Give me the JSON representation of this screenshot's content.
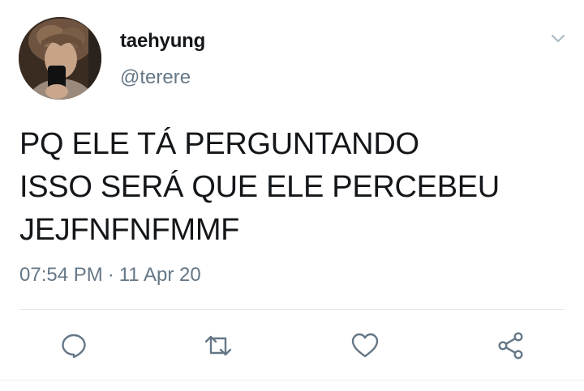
{
  "tweet": {
    "display_name": "taehyung",
    "handle": "@terere",
    "text_lines": [
      "PQ ELE TÁ PERGUNTANDO",
      "ISSO SERÁ QUE ELE PERCEBEU",
      "JEJFNFNFMMF"
    ],
    "time": "07:54 PM",
    "separator": "·",
    "date": "11 Apr 20"
  },
  "icons": {
    "menu": "chevron-down-icon",
    "reply": "reply-icon",
    "retweet": "retweet-icon",
    "like": "heart-icon",
    "share": "share-icon"
  },
  "colors": {
    "text": "#14171a",
    "secondary": "#657786",
    "icon": "#657786",
    "divider": "#e1e8ed"
  }
}
